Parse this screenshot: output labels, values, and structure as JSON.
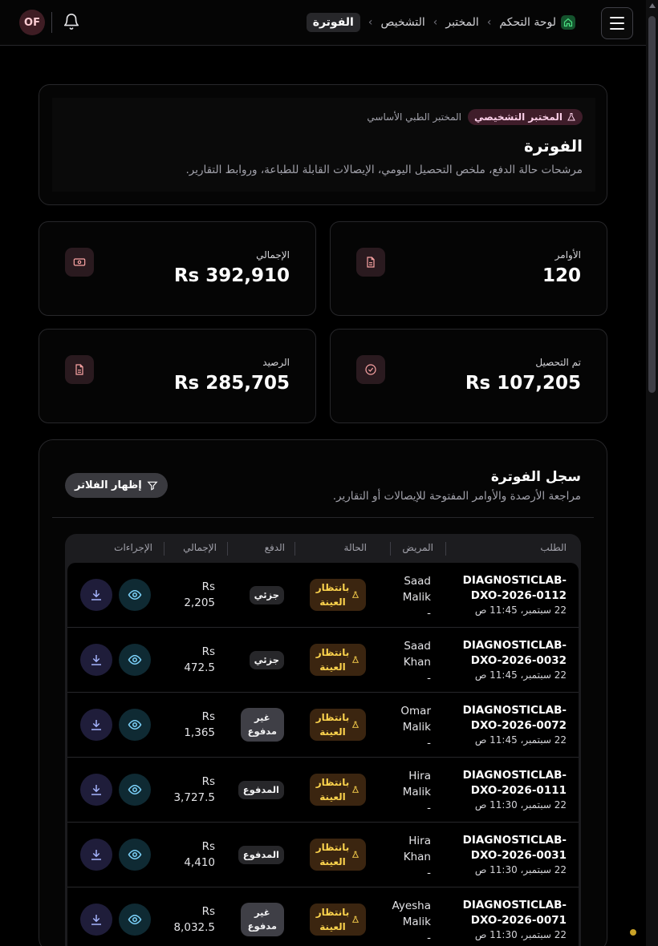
{
  "topbar": {
    "avatar_initials": "OF",
    "breadcrumb": [
      {
        "label": "لوحة التحكم"
      },
      {
        "label": "المختبر"
      },
      {
        "label": "التشخيص"
      },
      {
        "label": "الفوترة"
      }
    ],
    "separator": "‹"
  },
  "header": {
    "badge_primary": "المختبر التشخيصي",
    "badge_secondary": "المختبر الطبي الأساسي",
    "title": "الفوترة",
    "subtitle": "مرشحات حالة الدفع، ملخص التحصيل اليومي، الإيصالات القابلة للطباعة، وروابط التقارير."
  },
  "stats": [
    {
      "label": "الأوامر",
      "value": "120",
      "icon": "document-icon"
    },
    {
      "label": "الإجمالي",
      "value": "Rs 392,910",
      "icon": "cash-icon"
    },
    {
      "label": "تم التحصيل",
      "value": "Rs 107,205",
      "icon": "check-circle-icon"
    },
    {
      "label": "الرصيد",
      "value": "Rs 285,705",
      "icon": "document-icon"
    }
  ],
  "ledger": {
    "title": "سجل الفوترة",
    "subtitle": "مراجعة الأرصدة والأوامر المفتوحة للإيصالات أو التقارير.",
    "filter_label": "إظهار الفلاتر",
    "columns": {
      "order": "الطلب",
      "patient": "المريض",
      "status": "الحالة",
      "payment": "الدفع",
      "total": "الإجمالي",
      "actions": "الإجراءات"
    },
    "rows": [
      {
        "order_a": "DIAGNOSTICLAB-",
        "order_b": "DXO-2026-0112",
        "date": "22 سبتمبر، 11:45 ص",
        "patient_first": "Saad",
        "patient_last": "Malik",
        "patient_extra": "-",
        "status_a": "بانتظار",
        "status_b": "العينة",
        "payment_a": "جزئي",
        "payment_b": "",
        "total_a": "Rs",
        "total_b": "2,205"
      },
      {
        "order_a": "DIAGNOSTICLAB-",
        "order_b": "DXO-2026-0032",
        "date": "22 سبتمبر، 11:45 ص",
        "patient_first": "Saad",
        "patient_last": "Khan",
        "patient_extra": "-",
        "status_a": "بانتظار",
        "status_b": "العينة",
        "payment_a": "جزئي",
        "payment_b": "",
        "total_a": "Rs",
        "total_b": "472.5"
      },
      {
        "order_a": "DIAGNOSTICLAB-",
        "order_b": "DXO-2026-0072",
        "date": "22 سبتمبر، 11:45 ص",
        "patient_first": "Omar",
        "patient_last": "Malik",
        "patient_extra": "-",
        "status_a": "بانتظار",
        "status_b": "العينة",
        "payment_a": "غير",
        "payment_b": "مدفوع",
        "total_a": "Rs",
        "total_b": "1,365"
      },
      {
        "order_a": "DIAGNOSTICLAB-",
        "order_b": "DXO-2026-0111",
        "date": "22 سبتمبر، 11:30 ص",
        "patient_first": "Hira",
        "patient_last": "Malik",
        "patient_extra": "-",
        "status_a": "بانتظار",
        "status_b": "العينة",
        "payment_a": "المدفوع",
        "payment_b": "",
        "total_a": "Rs",
        "total_b": "3,727.5"
      },
      {
        "order_a": "DIAGNOSTICLAB-",
        "order_b": "DXO-2026-0031",
        "date": "22 سبتمبر، 11:30 ص",
        "patient_first": "Hira",
        "patient_last": "Khan",
        "patient_extra": "-",
        "status_a": "بانتظار",
        "status_b": "العينة",
        "payment_a": "المدفوع",
        "payment_b": "",
        "total_a": "Rs",
        "total_b": "4,410"
      },
      {
        "order_a": "DIAGNOSTICLAB-",
        "order_b": "DXO-2026-0071",
        "date": "22 سبتمبر، 11:30 ص",
        "patient_first": "Ayesha",
        "patient_last": "Malik",
        "patient_extra": "-",
        "status_a": "بانتظار",
        "status_b": "العينة",
        "payment_a": "غير",
        "payment_b": "مدفوع",
        "total_a": "Rs",
        "total_b": "8,032.5"
      }
    ]
  },
  "colors": {
    "background": "#000000",
    "card_border": "#27272a",
    "status_bg": "#3b2510",
    "status_text": "#fcd34d",
    "view_btn_bg": "#0f2a33",
    "download_btn_bg": "#1f1d3a"
  }
}
